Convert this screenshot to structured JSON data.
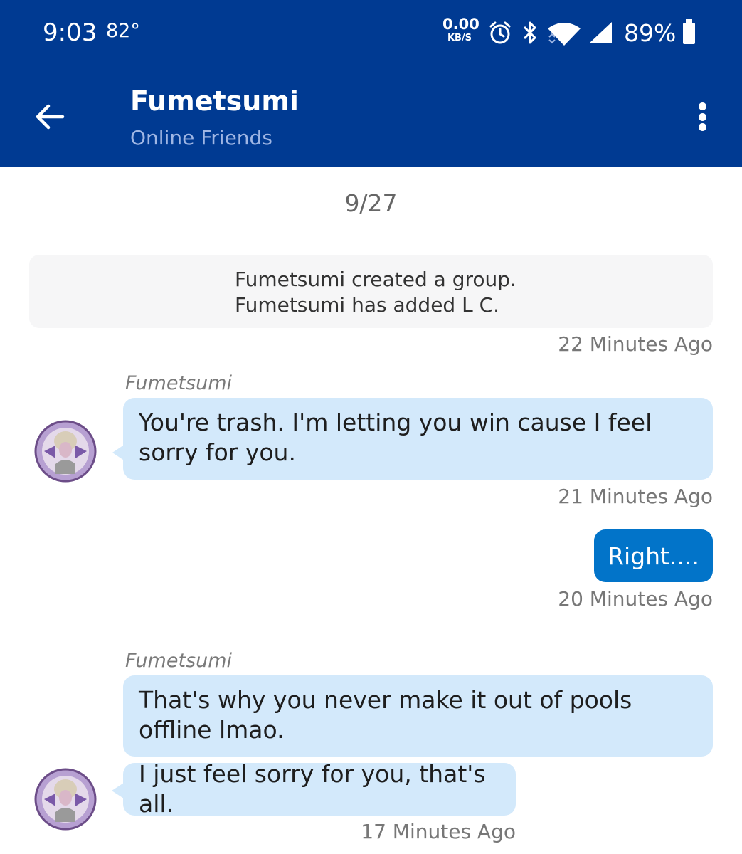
{
  "status_bar": {
    "time": "9:03",
    "temperature": "82°",
    "net_speed_value": "0.00",
    "net_speed_unit": "KB/S",
    "battery": "89%"
  },
  "header": {
    "title": "Fumetsumi",
    "subtitle": "Online Friends"
  },
  "chat": {
    "date_separator": "9/27",
    "system_message": {
      "line1": "Fumetsumi created a group.",
      "line2": "Fumetsumi has added L C.",
      "time": "22 Minutes Ago"
    },
    "messages": [
      {
        "sender": "Fumetsumi",
        "text": "You're trash. I'm letting you win cause I feel sorry for you.",
        "time": "21 Minutes Ago"
      },
      {
        "text": "Right....",
        "time": "20 Minutes Ago"
      },
      {
        "sender": "Fumetsumi",
        "text": "That's why you never make it out of pools offline lmao.",
        "text2": "I just feel sorry for you, that's all.",
        "time": "17 Minutes Ago"
      }
    ]
  },
  "colors": {
    "header": "#003a92",
    "incoming_bubble": "#d3e9fb",
    "outgoing_bubble": "#0274c9"
  },
  "icons": [
    "back-arrow-icon",
    "more-vert-icon",
    "alarm-icon",
    "bluetooth-icon",
    "wifi-icon",
    "cell-signal-icon",
    "battery-icon"
  ]
}
